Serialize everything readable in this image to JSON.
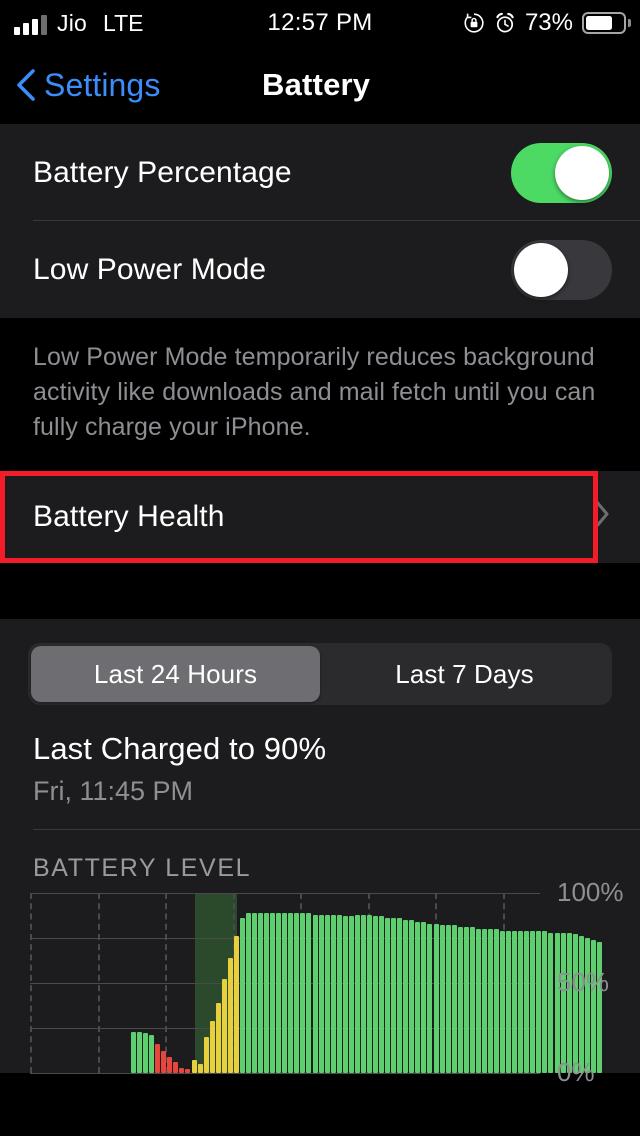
{
  "status_bar": {
    "carrier": "Jio",
    "network": "LTE",
    "time": "12:57 PM",
    "battery_percent": "73%",
    "icons": [
      "signal-bars-icon",
      "rotation-lock-icon",
      "alarm-clock-icon",
      "battery-icon"
    ]
  },
  "nav": {
    "back_label": "Settings",
    "title": "Battery"
  },
  "settings": {
    "battery_percentage": {
      "label": "Battery Percentage",
      "state": "on"
    },
    "low_power_mode": {
      "label": "Low Power Mode",
      "state": "off"
    },
    "footnote": "Low Power Mode temporarily reduces background activity like downloads and mail fetch until you can fully charge your iPhone.",
    "battery_health": {
      "label": "Battery Health",
      "highlighted": true,
      "highlight_color": "#f41c28"
    }
  },
  "usage": {
    "segments": [
      {
        "label": "Last 24 Hours",
        "selected": true
      },
      {
        "label": "Last 7 Days",
        "selected": false
      }
    ],
    "last_charged_title": "Last Charged to 90%",
    "last_charged_sub": "Fri, 11:45 PM",
    "chart_header": "BATTERY LEVEL"
  },
  "colors": {
    "accent_blue": "#3b8dfa",
    "toggle_on": "#4cd964",
    "toggle_off": "#39393d",
    "bar_green": "#5ecf6e",
    "bar_yellow": "#e8cf3c",
    "bar_red": "#e8453c",
    "charging_band": "#2b4a2c",
    "group_bg": "#1c1c1e",
    "page_bg": "#000000"
  },
  "chart_data": {
    "type": "bar",
    "title": "BATTERY LEVEL",
    "xlabel": "",
    "ylabel": "",
    "ylim": [
      0,
      100
    ],
    "ytick_labels": [
      "100%",
      "50%",
      "0%"
    ],
    "yticks": [
      100,
      50,
      0
    ],
    "gridlines_horizontal": [
      0,
      25,
      50,
      75,
      100
    ],
    "grid": true,
    "legend": "none",
    "charging_band": {
      "start_index": 11,
      "end_index": 15,
      "label": "charging-period"
    },
    "series": [
      {
        "name": "Battery Level",
        "colors": [
          "green",
          "yellow",
          "red"
        ],
        "bars": [
          {
            "i": 0,
            "value": 23,
            "color": "green"
          },
          {
            "i": 1,
            "value": 23,
            "color": "green"
          },
          {
            "i": 2,
            "value": 22,
            "color": "green"
          },
          {
            "i": 3,
            "value": 21,
            "color": "green"
          },
          {
            "i": 4,
            "value": 16,
            "color": "red"
          },
          {
            "i": 5,
            "value": 12,
            "color": "red"
          },
          {
            "i": 6,
            "value": 9,
            "color": "red"
          },
          {
            "i": 7,
            "value": 6,
            "color": "red"
          },
          {
            "i": 8,
            "value": 3,
            "color": "red"
          },
          {
            "i": 9,
            "value": 2,
            "color": "red"
          },
          {
            "i": 10,
            "value": 7,
            "color": "yellow"
          },
          {
            "i": 11,
            "value": 5,
            "color": "yellow"
          },
          {
            "i": 12,
            "value": 20,
            "color": "yellow"
          },
          {
            "i": 13,
            "value": 29,
            "color": "yellow"
          },
          {
            "i": 14,
            "value": 39,
            "color": "yellow"
          },
          {
            "i": 15,
            "value": 52,
            "color": "yellow"
          },
          {
            "i": 16,
            "value": 64,
            "color": "yellow"
          },
          {
            "i": 17,
            "value": 76,
            "color": "yellow"
          },
          {
            "i": 18,
            "value": 86,
            "color": "green"
          },
          {
            "i": 19,
            "value": 89,
            "color": "green"
          },
          {
            "i": 20,
            "value": 89,
            "color": "green"
          },
          {
            "i": 21,
            "value": 89,
            "color": "green"
          },
          {
            "i": 22,
            "value": 89,
            "color": "green"
          },
          {
            "i": 23,
            "value": 89,
            "color": "green"
          },
          {
            "i": 24,
            "value": 89,
            "color": "green"
          },
          {
            "i": 25,
            "value": 89,
            "color": "green"
          },
          {
            "i": 26,
            "value": 89,
            "color": "green"
          },
          {
            "i": 27,
            "value": 89,
            "color": "green"
          },
          {
            "i": 28,
            "value": 89,
            "color": "green"
          },
          {
            "i": 29,
            "value": 89,
            "color": "green"
          },
          {
            "i": 30,
            "value": 88,
            "color": "green"
          },
          {
            "i": 31,
            "value": 88,
            "color": "green"
          },
          {
            "i": 32,
            "value": 88,
            "color": "green"
          },
          {
            "i": 33,
            "value": 88,
            "color": "green"
          },
          {
            "i": 34,
            "value": 88,
            "color": "green"
          },
          {
            "i": 35,
            "value": 87,
            "color": "green"
          },
          {
            "i": 36,
            "value": 87,
            "color": "green"
          },
          {
            "i": 37,
            "value": 88,
            "color": "green"
          },
          {
            "i": 38,
            "value": 88,
            "color": "green"
          },
          {
            "i": 39,
            "value": 88,
            "color": "green"
          },
          {
            "i": 40,
            "value": 87,
            "color": "green"
          },
          {
            "i": 41,
            "value": 87,
            "color": "green"
          },
          {
            "i": 42,
            "value": 86,
            "color": "green"
          },
          {
            "i": 43,
            "value": 86,
            "color": "green"
          },
          {
            "i": 44,
            "value": 86,
            "color": "green"
          },
          {
            "i": 45,
            "value": 85,
            "color": "green"
          },
          {
            "i": 46,
            "value": 85,
            "color": "green"
          },
          {
            "i": 47,
            "value": 84,
            "color": "green"
          },
          {
            "i": 48,
            "value": 84,
            "color": "green"
          },
          {
            "i": 49,
            "value": 83,
            "color": "green"
          },
          {
            "i": 50,
            "value": 83,
            "color": "green"
          },
          {
            "i": 51,
            "value": 82,
            "color": "green"
          },
          {
            "i": 52,
            "value": 82,
            "color": "green"
          },
          {
            "i": 53,
            "value": 82,
            "color": "green"
          },
          {
            "i": 54,
            "value": 81,
            "color": "green"
          },
          {
            "i": 55,
            "value": 81,
            "color": "green"
          },
          {
            "i": 56,
            "value": 81,
            "color": "green"
          },
          {
            "i": 57,
            "value": 80,
            "color": "green"
          },
          {
            "i": 58,
            "value": 80,
            "color": "green"
          },
          {
            "i": 59,
            "value": 80,
            "color": "green"
          },
          {
            "i": 60,
            "value": 80,
            "color": "green"
          },
          {
            "i": 61,
            "value": 79,
            "color": "green"
          },
          {
            "i": 62,
            "value": 79,
            "color": "green"
          },
          {
            "i": 63,
            "value": 79,
            "color": "green"
          },
          {
            "i": 64,
            "value": 79,
            "color": "green"
          },
          {
            "i": 65,
            "value": 79,
            "color": "green"
          },
          {
            "i": 66,
            "value": 79,
            "color": "green"
          },
          {
            "i": 67,
            "value": 79,
            "color": "green"
          },
          {
            "i": 68,
            "value": 79,
            "color": "green"
          },
          {
            "i": 69,
            "value": 78,
            "color": "green"
          },
          {
            "i": 70,
            "value": 78,
            "color": "green"
          },
          {
            "i": 71,
            "value": 78,
            "color": "green"
          },
          {
            "i": 72,
            "value": 78,
            "color": "green"
          },
          {
            "i": 73,
            "value": 77,
            "color": "green"
          },
          {
            "i": 74,
            "value": 76,
            "color": "green"
          },
          {
            "i": 75,
            "value": 75,
            "color": "green"
          },
          {
            "i": 76,
            "value": 74,
            "color": "green"
          },
          {
            "i": 77,
            "value": 73,
            "color": "green"
          }
        ]
      }
    ]
  }
}
